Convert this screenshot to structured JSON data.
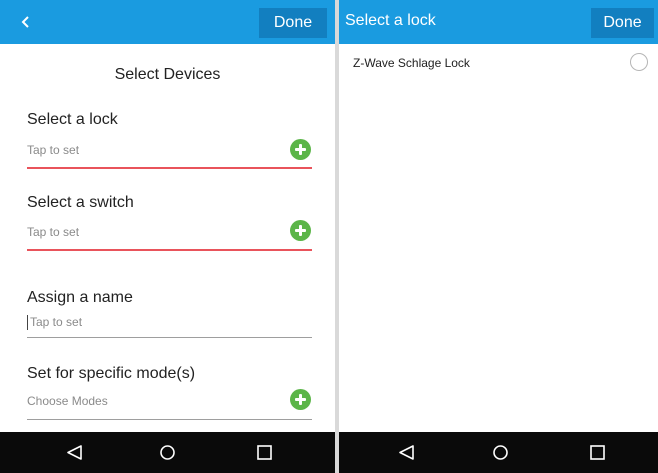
{
  "select_devices_screen": {
    "done_label": "Done",
    "title": "Select Devices",
    "lock": {
      "label": "Select a lock",
      "value": "Tap to set"
    },
    "switch": {
      "label": "Select a switch",
      "value": "Tap to set"
    },
    "name": {
      "label": "Assign a name",
      "placeholder": "Tap to set"
    },
    "modes": {
      "label": "Set for specific mode(s)",
      "value": "Choose Modes"
    }
  },
  "select_lock_screen": {
    "title": "Select a lock",
    "done_label": "Done",
    "locks": [
      {
        "name": "Z-Wave Schlage Lock",
        "selected": false
      }
    ]
  },
  "colors": {
    "app_bar": "#1a9be0",
    "done_button": "#127fc0",
    "add_icon": "#5bb548",
    "error_underline": "#e9535b",
    "nav_bar": "#0a0a0a"
  },
  "icons": {
    "back": "chevron-left-icon",
    "add": "plus-circle-icon",
    "nav_back": "triangle-back-icon",
    "nav_home": "circle-home-icon",
    "nav_recents": "square-recents-icon"
  }
}
